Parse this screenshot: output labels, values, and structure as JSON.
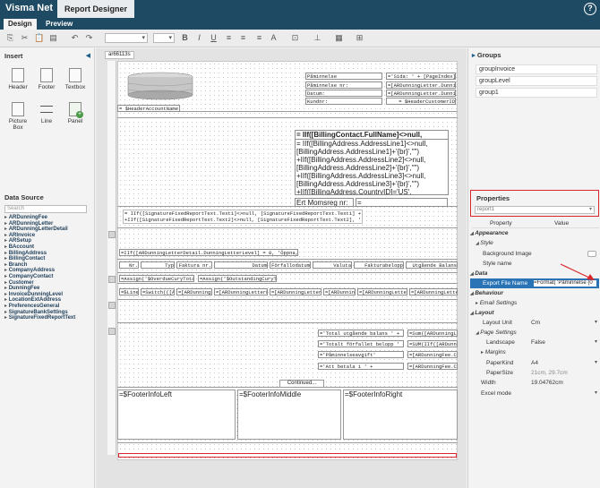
{
  "app": {
    "brand": "Visma Net",
    "tab": "Report Designer",
    "help": "?"
  },
  "subtabs": {
    "design": "Design",
    "preview": "Preview"
  },
  "insert": {
    "title": "Insert",
    "items": [
      "Header",
      "Footer",
      "Textbox",
      "Picture Box",
      "Line",
      "Panel"
    ]
  },
  "datasource": {
    "title": "Data Source",
    "search_placeholder": "Search",
    "items": [
      "ARDunningFee",
      "ARDunningLetter",
      "ARDunningLetterDetail",
      "ARInvoice",
      "ARSetup",
      "BAccount",
      "BillingAddress",
      "BillingContact",
      "Branch",
      "CompanyAddress",
      "CompanyContact",
      "Customer",
      "DunningFee",
      "InvoiceDunningLevel",
      "LocationExtAddress",
      "PreferencesGeneral",
      "SignatureBankSettings",
      "SignatureFixedReportText"
    ]
  },
  "designer": {
    "doc_tab": "ar66113s",
    "header_fields": {
      "paminnelse_label": "Påminnelse",
      "sida": "='Sida: ' + [PageIndex] +",
      "paminnelse_nr_label": "Påminnelse nr:",
      "dunning_1": "=[ARDunningLetter.Dunning",
      "datum_label": "Datum:",
      "dunning_2": "=[ARDunningLetter.Dunning",
      "kundnr_label": "Kundnr:",
      "customer_id": "= $HeaderCustomerID",
      "account_name": "= $HeaderAccountName"
    },
    "address_block": {
      "title": "= IIf([BillingContact.FullName]<>null,",
      "body": "= IIf([BillingAddress.AddressLine1]<>null,\n[BillingAddress.AddressLine1]+'{br}',\"\")\n+IIf([BillingAddress.AddressLine2]<>null,\n[BillingAddress.AddressLine2]+'{br}',\"\")\n+IIf([BillingAddress.AddressLine3]<>null,\n[BillingAddress.AddressLine3]+'{br}',\"\")\n+IIf([BillingAddress.CountryID]='US',\n   IIf([BillingAddress.City]<>null, [BillingAddress.City] +"
    },
    "moms_label": "Ert Momsreg nr:",
    "moms_value": "=",
    "fixed_text": "= IIf([SignatureFixedReportText.Text1]<>null, [SignatureFixedReportText.Text1] + '{br}', '')\n+IIf([SignatureFixedReportText.Text2]<>null, [SignatureFixedReportText.Text2], '')",
    "iif_level": "=IIf([ARDunningLetterDetail.DunningLetterLevel] = 0, 'Öppna, ej",
    "columns": [
      "Nr.",
      "Typ",
      "Faktura nr.",
      "Datum",
      "Förfallodatum",
      "Valuta",
      "Fakturabelopp",
      "Utgående Balans"
    ],
    "assign_overdue": "=Assign('$OverdueCuryTotal'",
    "assign_outstanding": "=Assign('$OutstandingCuryTo",
    "detail_row": [
      "=$Line",
      "=Switch(([ARDu",
      "=[ARDunningLe",
      "=[ARDunningLetterD",
      "=[ARDunningLetterD",
      "=[ARDunningL",
      "=[ARDunningLetterD",
      "=[ARDunningLetterD"
    ],
    "totals": [
      {
        "label": "='Total utgående balans ' +",
        "value": "=Sum([ARDunningLetter"
      },
      {
        "label": "='Totalt förfallet belopp ' +",
        "value": "=SUM(IIf([ARDunning"
      },
      {
        "label": "='Påminnelseavgift'",
        "value": "=[ARDunningFee.Cu"
      },
      {
        "label": "='Att betala i ' +",
        "value": "=[ARDunningFee.Cu"
      }
    ],
    "continued": "Continued...",
    "footer": {
      "left": "=$FooterInfoLeft",
      "middle": "=$FooterInfoMiddle",
      "right": "=$FooterInfoRight"
    }
  },
  "groups": {
    "title": "Groups",
    "items": [
      "groupInvoice",
      "groupLevel",
      "group1"
    ]
  },
  "properties": {
    "title": "Properties",
    "selected": "report1",
    "col_property": "Property",
    "col_value": "Value",
    "rows": {
      "appearance": "Appearance",
      "style": "Style",
      "background_image": "Background Image",
      "style_name": "Style name",
      "data": "Data",
      "export_file_name": "Export File Name",
      "export_file_value": "=Format( 'Påminnelse {0",
      "behaviour": "Behaviour",
      "email_settings": "Email Settings",
      "layout": "Layout",
      "layout_unit": "Layout Unit",
      "layout_unit_value": "Cm",
      "page_settings": "Page Settings",
      "landscape": "Landscape",
      "landscape_value": "False",
      "margins": "Margins",
      "paper_kind": "PaperKind",
      "paper_kind_value": "A4",
      "paper_size": "PaperSize",
      "paper_size_value": "21cm, 29.7cm",
      "width": "Width",
      "width_value": "19.04762cm",
      "excel_mode": "Excel mode"
    }
  },
  "colors": {
    "titlebar": "#1f4a64",
    "highlight": "#d9262c",
    "selected_row": "#2a74b6"
  }
}
